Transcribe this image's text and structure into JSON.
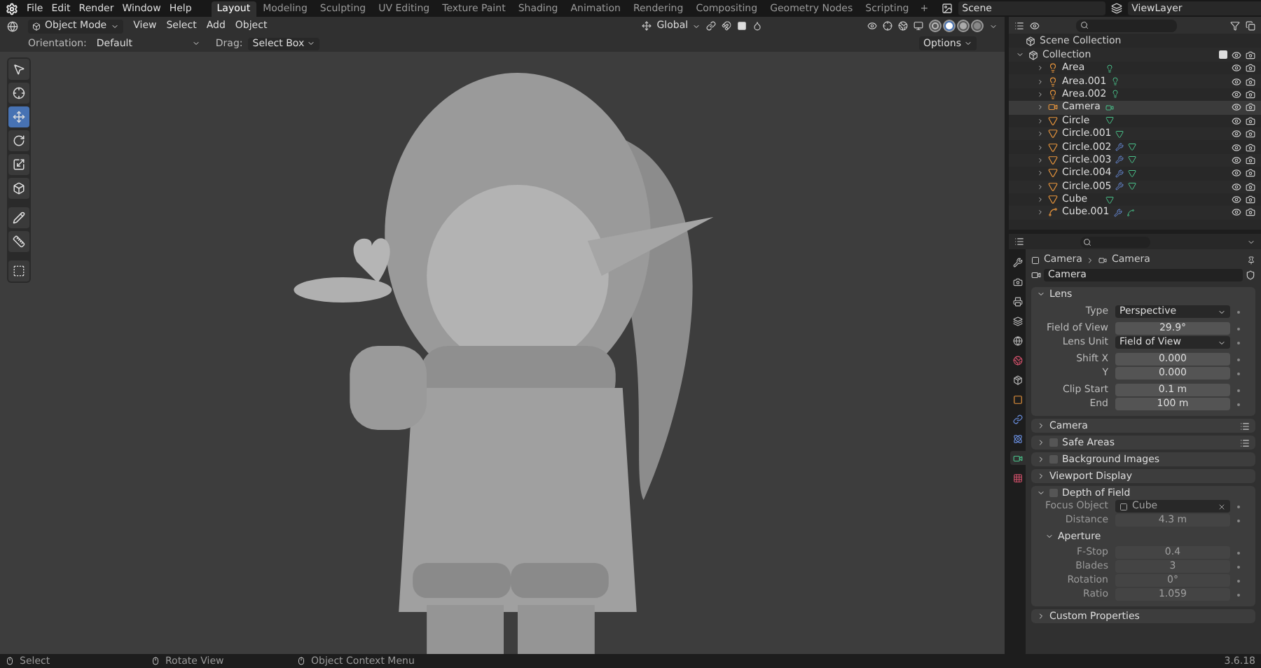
{
  "menu": [
    "File",
    "Edit",
    "Render",
    "Window",
    "Help"
  ],
  "workspaces": [
    {
      "label": "Layout",
      "selected": true
    },
    {
      "label": "Modeling",
      "selected": false
    },
    {
      "label": "Sculpting",
      "selected": false
    },
    {
      "label": "UV Editing",
      "selected": false
    },
    {
      "label": "Texture Paint",
      "selected": false
    },
    {
      "label": "Shading",
      "selected": false
    },
    {
      "label": "Animation",
      "selected": false
    },
    {
      "label": "Rendering",
      "selected": false
    },
    {
      "label": "Compositing",
      "selected": false
    },
    {
      "label": "Geometry Nodes",
      "selected": false
    },
    {
      "label": "Scripting",
      "selected": false
    }
  ],
  "add_workspace": "+",
  "scene": "Scene",
  "view_layer": "ViewLayer",
  "header": {
    "mode": "Object Mode",
    "menus": [
      "View",
      "Select",
      "Add",
      "Object"
    ],
    "orientation": "Global",
    "shading": [
      {
        "kind": "wire",
        "selected": false
      },
      {
        "kind": "solid",
        "selected": true
      },
      {
        "kind": "material",
        "selected": false
      },
      {
        "kind": "rendered",
        "selected": false
      }
    ]
  },
  "tool_settings": {
    "orientation_label": "Orientation:",
    "orientation": "Default",
    "drag_label": "Drag:",
    "drag": "Select Box",
    "options": "Options"
  },
  "tools": [
    {
      "kind": "select",
      "selected": false
    },
    {
      "kind": "cursor",
      "selected": false
    },
    {
      "kind": "move",
      "selected": true
    },
    {
      "kind": "rotate",
      "selected": false
    },
    {
      "kind": "scale",
      "selected": false
    },
    {
      "kind": "transform",
      "selected": false
    },
    {
      "kind": "annotate",
      "selected": false
    },
    {
      "kind": "measure",
      "selected": false
    },
    {
      "kind": "add",
      "selected": false
    }
  ],
  "outliner": {
    "root": "Scene Collection",
    "collection": {
      "name": "Collection",
      "expanded": true,
      "checked": true,
      "children": [
        {
          "name": "Area",
          "kind": "light",
          "selected": false,
          "modifier": false
        },
        {
          "name": "Area.001",
          "kind": "light",
          "selected": false,
          "modifier": false
        },
        {
          "name": "Area.002",
          "kind": "light",
          "selected": false,
          "modifier": false
        },
        {
          "name": "Camera",
          "kind": "camera",
          "selected": true,
          "modifier": false
        },
        {
          "name": "Circle",
          "kind": "mesh",
          "selected": false,
          "modifier": false
        },
        {
          "name": "Circle.001",
          "kind": "mesh",
          "selected": false,
          "modifier": false
        },
        {
          "name": "Circle.002",
          "kind": "mesh",
          "selected": false,
          "modifier": true
        },
        {
          "name": "Circle.003",
          "kind": "mesh",
          "selected": false,
          "modifier": true
        },
        {
          "name": "Circle.004",
          "kind": "mesh",
          "selected": false,
          "modifier": true
        },
        {
          "name": "Circle.005",
          "kind": "mesh",
          "selected": false,
          "modifier": true
        },
        {
          "name": "Cube",
          "kind": "mesh",
          "selected": false,
          "modifier": false
        },
        {
          "name": "Cube.001",
          "kind": "curve",
          "selected": false,
          "modifier": true
        }
      ]
    }
  },
  "property_tabs": [
    {
      "kind": "tool",
      "selected": false
    },
    {
      "kind": "render",
      "selected": false
    },
    {
      "kind": "output",
      "selected": false
    },
    {
      "kind": "view_layer",
      "selected": false
    },
    {
      "kind": "scene",
      "selected": false
    },
    {
      "kind": "world",
      "selected": false
    },
    {
      "kind": "collection",
      "selected": false
    },
    {
      "kind": "object",
      "selected": false
    },
    {
      "kind": "constraints",
      "selected": false
    },
    {
      "kind": "physics",
      "selected": false
    },
    {
      "kind": "data",
      "selected": true
    },
    {
      "kind": "texture",
      "selected": false
    }
  ],
  "properties": {
    "breadcrumb": [
      "Camera",
      "Camera"
    ],
    "data_name": "Camera",
    "lens": {
      "title": "Lens",
      "expanded": true,
      "groups": [
        [
          {
            "kind": "dropdown",
            "label": "Type",
            "value": "Perspective",
            "disabled": false
          }
        ],
        [
          {
            "kind": "number",
            "label": "Field of View",
            "value": "29.9°",
            "disabled": false
          },
          {
            "kind": "dropdown",
            "label": "Lens Unit",
            "value": "Field of View",
            "disabled": false
          }
        ],
        [
          {
            "kind": "number",
            "label": "Shift X",
            "value": "0.000",
            "disabled": false
          },
          {
            "kind": "number",
            "label": "Y",
            "value": "0.000",
            "disabled": false
          }
        ],
        [
          {
            "kind": "number",
            "label": "Clip Start",
            "value": "0.1 m",
            "disabled": false
          },
          {
            "kind": "number",
            "label": "End",
            "value": "100 m",
            "disabled": false
          }
        ]
      ]
    },
    "panels": [
      {
        "title": "Camera",
        "expanded": false,
        "presets": true
      },
      {
        "title": "Safe Areas",
        "expanded": false,
        "checkbox": false,
        "presets": true
      },
      {
        "title": "Background Images",
        "expanded": false,
        "checkbox": false,
        "presets": false
      },
      {
        "title": "Viewport Display",
        "expanded": false,
        "presets": false
      },
      {
        "title": "Depth of Field",
        "expanded": true,
        "checkbox": false,
        "presets": false,
        "rows": [
          {
            "kind": "object",
            "label": "Focus Object",
            "value": "Cube",
            "disabled": true
          },
          {
            "kind": "number",
            "label": "Distance",
            "value": "4.3 m",
            "disabled": true
          }
        ],
        "subpanel": {
          "title": "Aperture",
          "expanded": true,
          "rows": [
            {
              "kind": "number",
              "label": "F-Stop",
              "value": "0.4",
              "disabled": true
            },
            {
              "kind": "number",
              "label": "Blades",
              "value": "3",
              "disabled": true
            },
            {
              "kind": "number",
              "label": "Rotation",
              "value": "0°",
              "disabled": true
            },
            {
              "kind": "number",
              "label": "Ratio",
              "value": "1.059",
              "disabled": true
            }
          ]
        }
      },
      {
        "title": "Custom Properties",
        "expanded": false,
        "presets": false
      }
    ]
  },
  "status_bar": {
    "hints": [
      "Select",
      "Rotate View",
      "Object Context Menu"
    ],
    "version": "3.6.18"
  }
}
